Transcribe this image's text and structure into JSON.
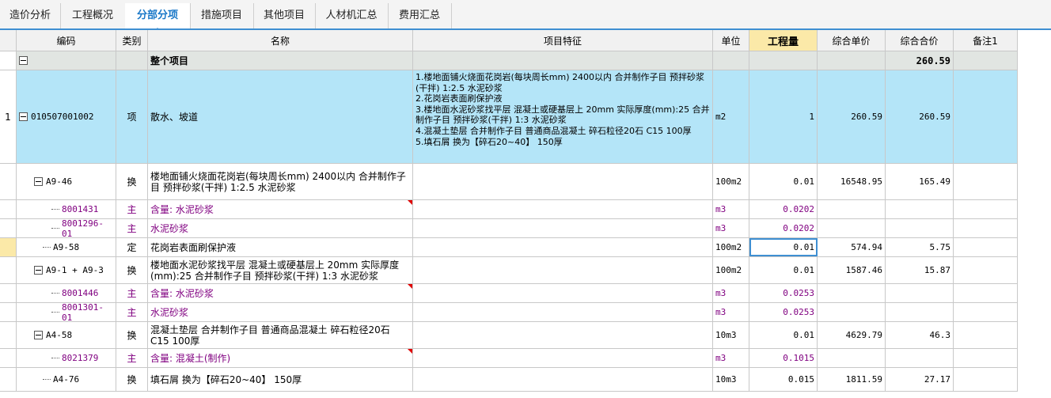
{
  "tabs": [
    "造价分析",
    "工程概况",
    "分部分项",
    "措施项目",
    "其他项目",
    "人材机汇总",
    "费用汇总"
  ],
  "active_tab": "分部分项",
  "columns": {
    "code": "编码",
    "type": "类别",
    "name": "名称",
    "feature": "项目特征",
    "unit": "单位",
    "qty": "工程量",
    "unit_price": "综合单价",
    "total_price": "综合合价",
    "note": "备注1"
  },
  "total_row": {
    "name": "整个项目",
    "total_price": "260.59"
  },
  "item": {
    "index": "1",
    "code": "010507001002",
    "type": "项",
    "name": "散水、坡道",
    "feature": "1.楼地面铺火烧面花岗岩(每块周长mm) 2400以内  合并制作子目 预拌砂浆(干拌) 1:2.5 水泥砂浆\n2.花岗岩表面刷保护液\n3.楼地面水泥砂浆找平层 混凝土或硬基层上 20mm  实际厚度(mm):25  合并制作子目  预拌砂浆(干拌) 1:3 水泥砂浆\n4.混凝土垫层  合并制作子目 普通商品混凝土 碎石粒径20石 C15 100厚\n5.填石屑  换为【碎石20~40】 150厚",
    "unit": "m2",
    "qty": "1",
    "unit_price": "260.59",
    "total_price": "260.59"
  },
  "rows": [
    {
      "code": "A9-46",
      "type": "换",
      "name": "楼地面铺火烧面花岗岩(每块周长mm) 2400以内  合并制作子目 预拌砂浆(干拌) 1:2.5 水泥砂浆",
      "unit": "100m2",
      "qty": "0.01",
      "unit_price": "16548.95",
      "total_price": "165.49"
    },
    {
      "code": "8001431",
      "type": "主",
      "name": "含量: 水泥砂浆",
      "unit": "m3",
      "qty": "0.0202",
      "unit_price": "",
      "total_price": ""
    },
    {
      "code": "8001296-01",
      "type": "主",
      "name": "水泥砂浆",
      "unit": "m3",
      "qty": "0.0202",
      "unit_price": "",
      "total_price": ""
    },
    {
      "code": "A9-58",
      "type": "定",
      "name": "花岗岩表面刷保护液",
      "unit": "100m2",
      "qty": "0.01",
      "unit_price": "574.94",
      "total_price": "5.75"
    },
    {
      "code": "A9-1 + A9-3",
      "type": "换",
      "name": "楼地面水泥砂浆找平层 混凝土或硬基层上 20mm  实际厚度(mm):25  合并制作子目 预拌砂浆(干拌) 1:3 水泥砂浆",
      "unit": "100m2",
      "qty": "0.01",
      "unit_price": "1587.46",
      "total_price": "15.87"
    },
    {
      "code": "8001446",
      "type": "主",
      "name": "含量: 水泥砂浆",
      "unit": "m3",
      "qty": "0.0253",
      "unit_price": "",
      "total_price": ""
    },
    {
      "code": "8001301-01",
      "type": "主",
      "name": "水泥砂浆",
      "unit": "m3",
      "qty": "0.0253",
      "unit_price": "",
      "total_price": ""
    },
    {
      "code": "A4-58",
      "type": "换",
      "name": "混凝土垫层  合并制作子目 普通商品混凝土 碎石粒径20石 C15 100厚",
      "unit": "10m3",
      "qty": "0.01",
      "unit_price": "4629.79",
      "total_price": "46.3"
    },
    {
      "code": "8021379",
      "type": "主",
      "name": "含量: 混凝土(制作)",
      "unit": "m3",
      "qty": "0.1015",
      "unit_price": "",
      "total_price": ""
    },
    {
      "code": "A4-76",
      "type": "换",
      "name": "填石屑  换为【碎石20~40】 150厚",
      "unit": "10m3",
      "qty": "0.015",
      "unit_price": "1811.59",
      "total_price": "27.17"
    }
  ],
  "colors": {
    "accent": "#3f8fd2",
    "item_row": "#b4e5f8",
    "total_row": "#e1e5e2",
    "material_text": "#800080",
    "qty_header": "#fbe9a8"
  }
}
